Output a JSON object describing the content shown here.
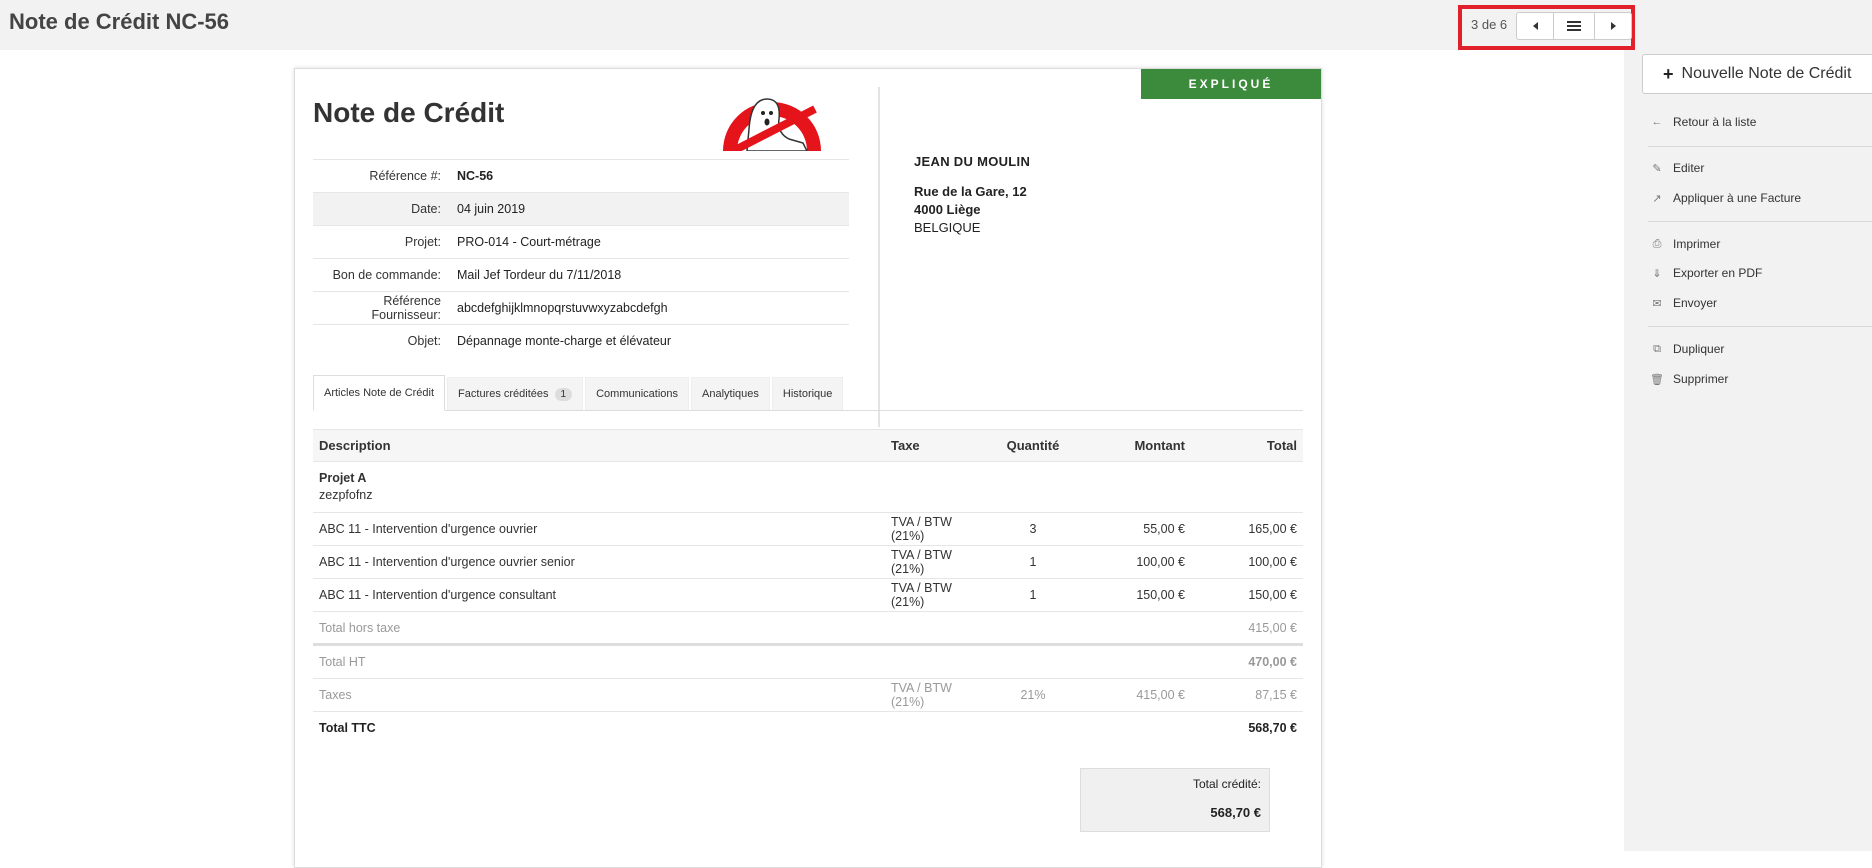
{
  "header": {
    "title": "Note de Crédit NC-56",
    "pager": {
      "count": "3 de 6"
    }
  },
  "sidebar": {
    "new_button": "Nouvelle Note de Crédit",
    "items": [
      {
        "label": "Retour à la liste",
        "icon": "arrow-left-icon"
      },
      {
        "label": "Editer",
        "icon": "pencil-icon"
      },
      {
        "label": "Appliquer à une Facture",
        "icon": "share-icon"
      },
      {
        "label": "Imprimer",
        "icon": "print-icon"
      },
      {
        "label": "Exporter en PDF",
        "icon": "download-icon"
      },
      {
        "label": "Envoyer",
        "icon": "envelope-icon"
      },
      {
        "label": "Dupliquer",
        "icon": "copy-icon"
      },
      {
        "label": "Supprimer",
        "icon": "trash-icon"
      }
    ]
  },
  "document": {
    "status": "EXPLIQUÉ",
    "status_color": "#3c8a3c",
    "title": "Note de Crédit",
    "fields": [
      {
        "label": "Référence #:",
        "value": "NC-56"
      },
      {
        "label": "Date:",
        "value": "04 juin 2019"
      },
      {
        "label": "Projet:",
        "value": "PRO-014 - Court-métrage"
      },
      {
        "label": "Bon de commande:",
        "value": "Mail Jef Tordeur du 7/11/2018"
      },
      {
        "label": "Référence Fournisseur:",
        "value": "abcdefghijklmnopqrstuvwxyzabcdefgh"
      },
      {
        "label": "Objet:",
        "value": "Dépannage monte-charge et élévateur"
      }
    ],
    "client": {
      "name": "JEAN DU MOULIN",
      "street": "Rue de la Gare, 12",
      "city": "4000 Liège",
      "country": "BELGIQUE"
    },
    "tabs": [
      {
        "label": "Articles Note de Crédit"
      },
      {
        "label": "Factures créditées",
        "count": "1"
      },
      {
        "label": "Communications"
      },
      {
        "label": "Analytiques"
      },
      {
        "label": "Historique"
      }
    ],
    "table": {
      "headers": {
        "description": "Description",
        "tax": "Taxe",
        "qty": "Quantité",
        "amount": "Montant",
        "total": "Total"
      },
      "group": {
        "name": "Projet A",
        "note": "zezpfofnz"
      },
      "rows": [
        {
          "description": "ABC 11 - Intervention d'urgence ouvrier",
          "tax": "TVA / BTW (21%)",
          "qty": "3",
          "amount": "55,00 €",
          "total": "165,00 €"
        },
        {
          "description": "ABC 11 - Intervention d'urgence ouvrier senior",
          "tax": "TVA / BTW (21%)",
          "qty": "1",
          "amount": "100,00 €",
          "total": "100,00 €"
        },
        {
          "description": "ABC 11 - Intervention d'urgence consultant",
          "tax": "TVA / BTW (21%)",
          "qty": "1",
          "amount": "150,00 €",
          "total": "150,00 €"
        }
      ],
      "subtotal": {
        "label": "Total hors taxe",
        "total": "415,00 €"
      },
      "total_ht": {
        "label": "Total HT",
        "total": "470,00 €"
      },
      "taxes": {
        "label": "Taxes",
        "tax": "TVA / BTW (21%)",
        "rate": "21%",
        "base": "415,00 €",
        "total": "87,15 €"
      },
      "total_ttc": {
        "label": "Total TTC",
        "total": "568,70 €"
      }
    },
    "credited": {
      "label": "Total crédité:",
      "amount": "568,70 €"
    }
  }
}
